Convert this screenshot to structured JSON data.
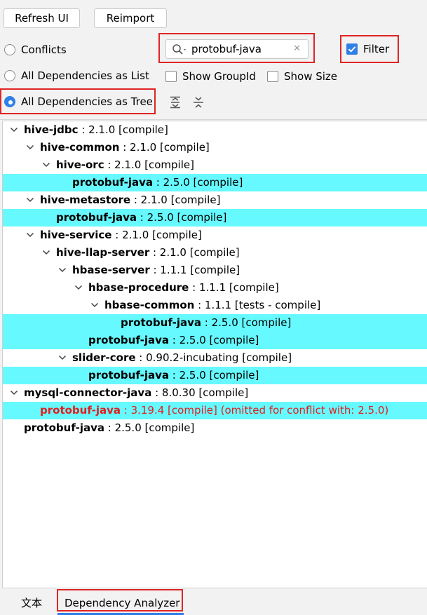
{
  "toolbar": {
    "refresh_label": "Refresh UI",
    "reimport_label": "Reimport"
  },
  "options": {
    "conflicts_label": "Conflicts",
    "list_label": "All Dependencies as List",
    "tree_label": "All Dependencies as Tree",
    "selected_view": "All Dependencies as Tree",
    "show_groupid_label": "Show GroupId",
    "show_size_label": "Show Size",
    "filter_label": "Filter",
    "filter_checked": true
  },
  "search": {
    "value": "protobuf-java",
    "clear_glyph": "✕"
  },
  "tree": [
    {
      "name": "hive-jdbc",
      "detail": " : 2.1.0 [compile]",
      "level": 0,
      "expanded": true,
      "highlight": false,
      "conflict": false
    },
    {
      "name": "hive-common",
      "detail": " : 2.1.0 [compile]",
      "level": 1,
      "expanded": true,
      "highlight": false,
      "conflict": false
    },
    {
      "name": "hive-orc",
      "detail": " : 2.1.0 [compile]",
      "level": 2,
      "expanded": true,
      "highlight": false,
      "conflict": false
    },
    {
      "name": "protobuf-java",
      "detail": " : 2.5.0 [compile]",
      "level": 3,
      "expanded": null,
      "highlight": true,
      "conflict": false
    },
    {
      "name": "hive-metastore",
      "detail": " : 2.1.0 [compile]",
      "level": 1,
      "expanded": true,
      "highlight": false,
      "conflict": false
    },
    {
      "name": "protobuf-java",
      "detail": " : 2.5.0 [compile]",
      "level": 2,
      "expanded": null,
      "highlight": true,
      "conflict": false
    },
    {
      "name": "hive-service",
      "detail": " : 2.1.0 [compile]",
      "level": 1,
      "expanded": true,
      "highlight": false,
      "conflict": false
    },
    {
      "name": "hive-llap-server",
      "detail": " : 2.1.0 [compile]",
      "level": 2,
      "expanded": true,
      "highlight": false,
      "conflict": false
    },
    {
      "name": "hbase-server",
      "detail": " : 1.1.1 [compile]",
      "level": 3,
      "expanded": true,
      "highlight": false,
      "conflict": false
    },
    {
      "name": "hbase-procedure",
      "detail": " : 1.1.1 [compile]",
      "level": 4,
      "expanded": true,
      "highlight": false,
      "conflict": false
    },
    {
      "name": "hbase-common",
      "detail": " : 1.1.1 [tests - compile]",
      "level": 5,
      "expanded": true,
      "highlight": false,
      "conflict": false
    },
    {
      "name": "protobuf-java",
      "detail": " : 2.5.0 [compile]",
      "level": 6,
      "expanded": null,
      "highlight": true,
      "conflict": false
    },
    {
      "name": "protobuf-java",
      "detail": " : 2.5.0 [compile]",
      "level": 4,
      "expanded": null,
      "highlight": true,
      "conflict": false
    },
    {
      "name": "slider-core",
      "detail": " : 0.90.2-incubating [compile]",
      "level": 3,
      "expanded": true,
      "highlight": false,
      "conflict": false
    },
    {
      "name": "protobuf-java",
      "detail": " : 2.5.0 [compile]",
      "level": 4,
      "expanded": null,
      "highlight": true,
      "conflict": false
    },
    {
      "name": "mysql-connector-java",
      "detail": " : 8.0.30 [compile]",
      "level": 0,
      "expanded": true,
      "highlight": false,
      "conflict": false
    },
    {
      "name": "protobuf-java",
      "detail": " : 3.19.4 [compile] (omitted for conflict with: 2.5.0)",
      "level": 1,
      "expanded": null,
      "highlight": true,
      "conflict": true
    },
    {
      "name": "protobuf-java",
      "detail": " : 2.5.0 [compile]",
      "level": 0,
      "expanded": null,
      "highlight": false,
      "conflict": false
    }
  ],
  "tabs": [
    {
      "label": "文本",
      "active": false
    },
    {
      "label": "Dependency Analyzer",
      "active": true
    }
  ],
  "colors": {
    "highlight": "#66f9ff",
    "conflict_text": "#e21e1e",
    "accent": "#2f7fe6",
    "annotation_box": "#e02424"
  },
  "icons": [
    "search-icon",
    "clear-icon",
    "expand-all-icon",
    "collapse-all-icon",
    "chevron-down-icon",
    "checkmark-icon"
  ]
}
